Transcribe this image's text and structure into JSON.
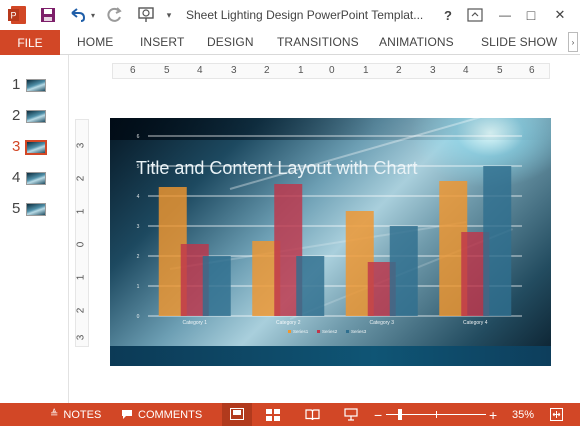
{
  "titlebar": {
    "app_badge": "P",
    "title": "Sheet Lighting Design PowerPoint Templat...",
    "help": "?",
    "minimize": "—",
    "restore": "□",
    "close": "✕"
  },
  "ribbon": {
    "file": "FILE",
    "tabs": [
      "HOME",
      "INSERT",
      "DESIGN",
      "TRANSITIONS",
      "ANIMATIONS",
      "SLIDE SHOW"
    ],
    "scroll": "›"
  },
  "thumbnails": [
    {
      "num": "1",
      "active": false
    },
    {
      "num": "2",
      "active": false
    },
    {
      "num": "3",
      "active": true
    },
    {
      "num": "4",
      "active": false
    },
    {
      "num": "5",
      "active": false
    }
  ],
  "hruler": [
    "6",
    "5",
    "4",
    "3",
    "2",
    "1",
    "0",
    "1",
    "2",
    "3",
    "4",
    "5",
    "6"
  ],
  "vruler": [
    "3",
    "2",
    "1",
    "0",
    "1",
    "2",
    "3"
  ],
  "slide": {
    "title": "Title and Content Layout with Chart"
  },
  "chart_data": {
    "type": "bar",
    "categories": [
      "Category 1",
      "Category 2",
      "Category 3",
      "Category 4"
    ],
    "series": [
      {
        "name": "Series1",
        "values": [
          4.3,
          2.5,
          3.5,
          4.5
        ],
        "color": "#f0962e"
      },
      {
        "name": "Series2",
        "values": [
          2.4,
          4.4,
          1.8,
          2.8
        ],
        "color": "#c0364a"
      },
      {
        "name": "Series3",
        "values": [
          2.0,
          2.0,
          3.0,
          5.0
        ],
        "color": "#2f6f8f"
      }
    ],
    "yticks": [
      "0",
      "1",
      "2",
      "3",
      "4",
      "5",
      "6"
    ],
    "ylim": [
      0,
      6
    ],
    "legend": [
      "Series1",
      "Series2",
      "Series3"
    ],
    "legend_position": "bottom",
    "grid": true
  },
  "statusbar": {
    "notes": "NOTES",
    "comments": "COMMENTS",
    "zoom_minus": "−",
    "zoom_plus": "+",
    "zoom_level": "35%"
  },
  "colors": {
    "accent": "#d24726",
    "slide_title": "#e8f2f6"
  }
}
